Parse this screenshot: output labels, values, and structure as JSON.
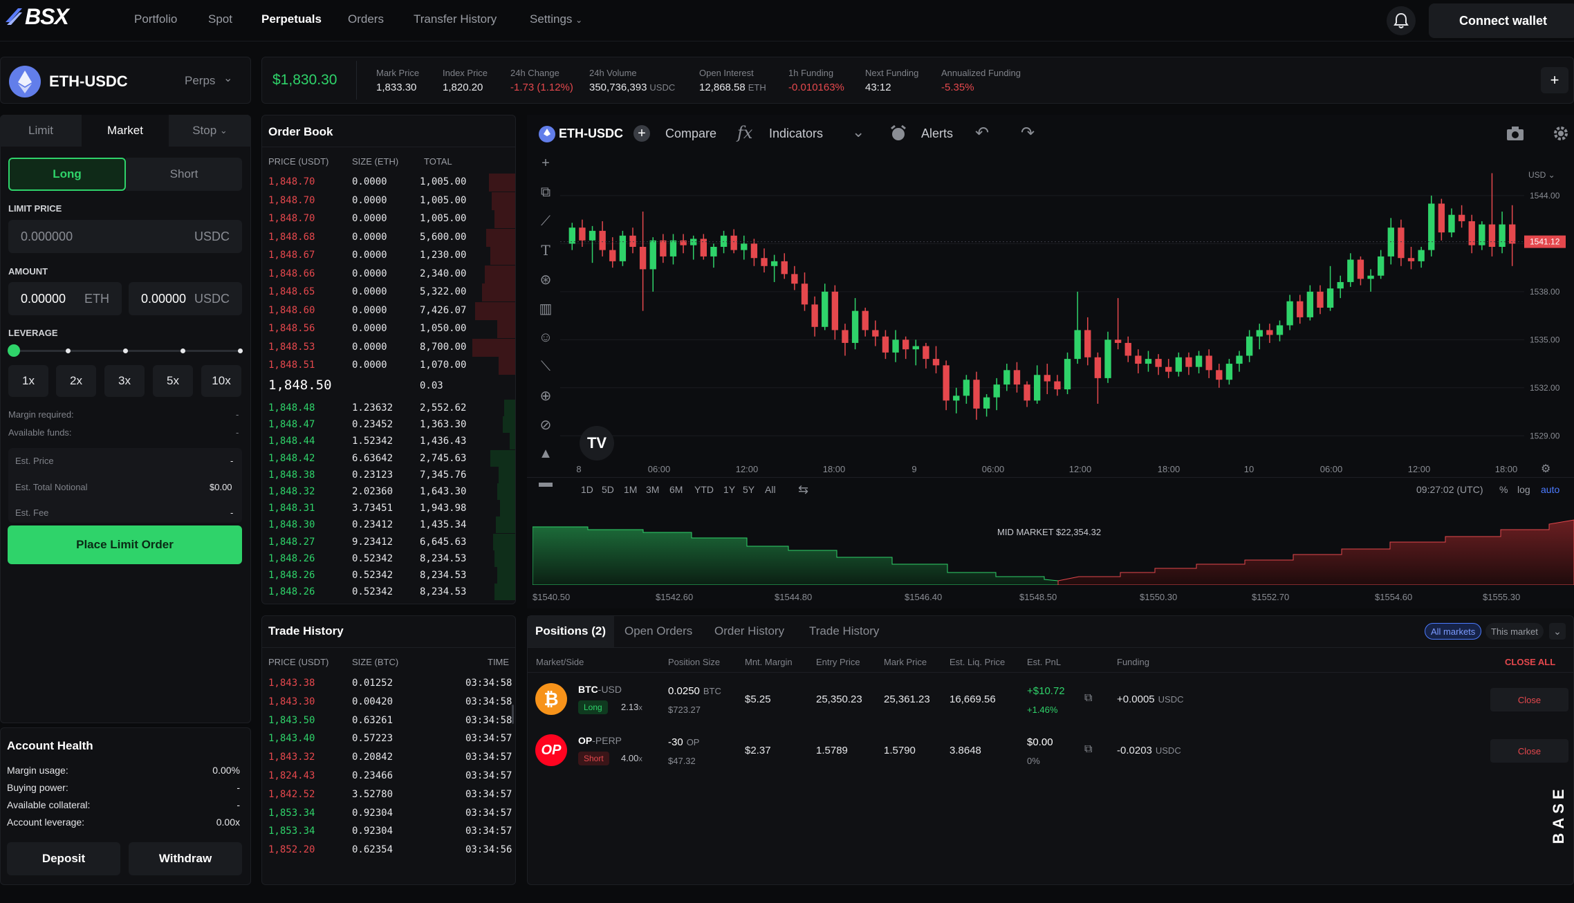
{
  "nav": {
    "logo": "BSX",
    "items": [
      "Portfolio",
      "Spot",
      "Perpetuals",
      "Orders",
      "Transfer History",
      "Settings"
    ],
    "connect": "Connect wallet"
  },
  "market": {
    "pair": "ETH-USDC",
    "type": "Perps",
    "price": "$1,830.30",
    "stats": [
      {
        "label": "Mark Price",
        "value": "1,833.30",
        "unit": "",
        "color": "#e6e7ea"
      },
      {
        "label": "Index Price",
        "value": "1,820.20",
        "unit": "",
        "color": "#e6e7ea"
      },
      {
        "label": "24h Change",
        "value": "-1.73 (1.12%)",
        "unit": "",
        "color": "#e5484d"
      },
      {
        "label": "24h Volume",
        "value": "350,736,393",
        "unit": "USDC",
        "color": "#e6e7ea"
      },
      {
        "label": "Open Interest",
        "value": "12,868.58",
        "unit": "ETH",
        "color": "#e6e7ea"
      },
      {
        "label": "1h Funding",
        "value": "-0.010163%",
        "unit": "",
        "color": "#e5484d"
      },
      {
        "label": "Next Funding",
        "value": "43:12",
        "unit": "",
        "color": "#e6e7ea"
      },
      {
        "label": "Annualized Funding",
        "value": "-5.35%",
        "unit": "",
        "color": "#e5484d"
      }
    ],
    "plus": "+"
  },
  "order_form": {
    "tabs": [
      "Limit",
      "Market",
      "Stop"
    ],
    "long": "Long",
    "short": "Short",
    "limit_price_label": "LIMIT PRICE",
    "limit_price_placeholder": "0.000000",
    "limit_price_unit": "USDC",
    "amount_label": "AMOUNT",
    "amount_eth": "0.00000",
    "amount_eth_unit": "ETH",
    "amount_usdc": "0.00000",
    "amount_usdc_unit": "USDC",
    "leverage_label": "LEVERAGE",
    "leverage_options": [
      "1x",
      "2x",
      "3x",
      "5x",
      "10x"
    ],
    "margin_required_label": "Margin required:",
    "margin_required": "-",
    "available_funds_label": "Available funds:",
    "available_funds": "-",
    "est_price_label": "Est. Price",
    "est_price": "-",
    "est_notional_label": "Est. Total Notional",
    "est_notional": "$0.00",
    "est_fee_label": "Est. Fee",
    "est_fee": "-",
    "place_order": "Place Limit Order"
  },
  "account": {
    "title": "Account Health",
    "rows": [
      {
        "label": "Margin usage:",
        "value": "0.00%"
      },
      {
        "label": "Buying power:",
        "value": "-"
      },
      {
        "label": "Available collateral:",
        "value": "-"
      },
      {
        "label": "Account leverage:",
        "value": "0.00x"
      }
    ],
    "deposit": "Deposit",
    "withdraw": "Withdraw"
  },
  "order_book": {
    "title": "Order Book",
    "headers": [
      "PRICE (USDT)",
      "SIZE (ETH)",
      "TOTAL"
    ],
    "asks": [
      [
        "1,848.70",
        "0.0000",
        "1,005.00"
      ],
      [
        "1,848.70",
        "0.0000",
        "1,005.00"
      ],
      [
        "1,848.70",
        "0.0000",
        "1,005.00"
      ],
      [
        "1,848.68",
        "0.0000",
        "5,600.00"
      ],
      [
        "1,848.67",
        "0.0000",
        "1,230.00"
      ],
      [
        "1,848.66",
        "0.0000",
        "2,340.00"
      ],
      [
        "1,848.65",
        "0.0000",
        "5,322.00"
      ],
      [
        "1,848.60",
        "0.0000",
        "7,426.07"
      ],
      [
        "1,848.56",
        "0.0000",
        "1,050.00"
      ],
      [
        "1,848.53",
        "0.0000",
        "8,700.00"
      ],
      [
        "1,848.51",
        "0.0000",
        "1,070.00"
      ]
    ],
    "mid_price": "1,848.50",
    "mid_size": "0.03",
    "bids": [
      [
        "1,848.48",
        "1.23632",
        "2,552.62"
      ],
      [
        "1,848.47",
        "0.23452",
        "1,363.30"
      ],
      [
        "1,848.44",
        "1.52342",
        "1,436.43"
      ],
      [
        "1,848.42",
        "6.63642",
        "2,745.63"
      ],
      [
        "1,848.38",
        "0.23123",
        "7,345.76"
      ],
      [
        "1,848.32",
        "2.02360",
        "1,643.30"
      ],
      [
        "1,848.31",
        "3.73451",
        "1,943.98"
      ],
      [
        "1,848.30",
        "0.23412",
        "1,435.34"
      ],
      [
        "1,848.27",
        "9.23412",
        "6,645.63"
      ],
      [
        "1,848.26",
        "0.52342",
        "8,234.53"
      ],
      [
        "1,848.26",
        "0.52342",
        "8,234.53"
      ],
      [
        "1,848.26",
        "0.52342",
        "8,234.53"
      ]
    ]
  },
  "trade_history": {
    "title": "Trade History",
    "headers": [
      "PRICE (USDT)",
      "SIZE (BTC)",
      "TIME"
    ],
    "rows": [
      {
        "price": "1,843.38",
        "size": "0.01252",
        "time": "03:34:58",
        "side": "sell"
      },
      {
        "price": "1,843.30",
        "size": "0.00420",
        "time": "03:34:58",
        "side": "sell"
      },
      {
        "price": "1,843.50",
        "size": "0.63261",
        "time": "03:34:58",
        "side": "buy"
      },
      {
        "price": "1,843.40",
        "size": "0.57223",
        "time": "03:34:57",
        "side": "buy"
      },
      {
        "price": "1,843.32",
        "size": "0.20842",
        "time": "03:34:57",
        "side": "sell"
      },
      {
        "price": "1,824.43",
        "size": "0.23466",
        "time": "03:34:57",
        "side": "sell"
      },
      {
        "price": "1,842.52",
        "size": "3.52780",
        "time": "03:34:57",
        "side": "sell"
      },
      {
        "price": "1,853.34",
        "size": "0.92304",
        "time": "03:34:57",
        "side": "buy"
      },
      {
        "price": "1,853.34",
        "size": "0.92304",
        "time": "03:34:57",
        "side": "buy"
      },
      {
        "price": "1,852.20",
        "size": "0.62354",
        "time": "03:34:56",
        "side": "sell"
      }
    ]
  },
  "chart": {
    "symbol": "ETH-USDC",
    "compare": "Compare",
    "indicators": "Indicators",
    "alerts": "Alerts",
    "currency": "USD",
    "current_price_tag": "1541.12",
    "y_ticks": [
      "1544.00",
      "1541.12",
      "1538.00",
      "1535.00",
      "1532.00",
      "1529.00"
    ],
    "x_ticks": [
      "8",
      "06:00",
      "12:00",
      "18:00",
      "9",
      "06:00",
      "12:00",
      "18:00",
      "10",
      "06:00",
      "12:00",
      "18:00"
    ],
    "timeframes": [
      "1D",
      "5D",
      "1M",
      "3M",
      "6M",
      "YTD",
      "1Y",
      "5Y",
      "All"
    ],
    "clock": "09:27:02 (UTC)",
    "scale_opts": [
      "%",
      "log",
      "auto"
    ],
    "brand": "TV"
  },
  "depth": {
    "mid_label": "MID MARKET $22,354.32",
    "x_ticks": [
      "$1540.50",
      "$1542.60",
      "$1544.80",
      "$1546.40",
      "$1548.50",
      "$1550.30",
      "$1552.70",
      "$1554.60",
      "$1555.30"
    ]
  },
  "positions": {
    "tabs": [
      "Positions (2)",
      "Open Orders",
      "Order History",
      "Trade History"
    ],
    "filters": [
      "All markets",
      "This market"
    ],
    "headers": [
      "Market/Side",
      "Position Size",
      "Mnt. Margin",
      "Entry Price",
      "Mark Price",
      "Est. Liq. Price",
      "Est. PnL",
      "Funding"
    ],
    "close_all": "CLOSE ALL",
    "rows": [
      {
        "icon": "bitcoin-icon",
        "market": "BTC",
        "quote": "-USD",
        "side": "Long",
        "lev": "2.13",
        "lev_x": "x",
        "size": "0.0250",
        "size_unit": "BTC",
        "size_usd": "$723.27",
        "margin": "$5.25",
        "entry": "25,350.23",
        "mark": "25,361.23",
        "liq": "16,669.56",
        "pnl": "+$10.72",
        "pnl_pct": "+1.46%",
        "funding": "+0.0005",
        "funding_unit": "USDC",
        "close": "Close"
      },
      {
        "icon": "op-icon",
        "market": "OP",
        "quote": "-PERP",
        "side": "Short",
        "lev": "4.00",
        "lev_x": "x",
        "size": "-30",
        "size_unit": "OP",
        "size_usd": "$47.32",
        "margin": "$2.37",
        "entry": "1.5789",
        "mark": "1.5790",
        "liq": "3.8648",
        "pnl": "$0.00",
        "pnl_pct": "0%",
        "funding": "-0.0203",
        "funding_unit": "USDC",
        "close": "Close"
      }
    ],
    "base_badge": "BASE"
  },
  "colors": {
    "green": "#2fd36a",
    "red": "#e5484d",
    "accent": "#4c7bff"
  },
  "candles": [
    [
      1541.0,
      1542.3,
      1540.6,
      1542.0
    ],
    [
      1542.0,
      1542.5,
      1540.8,
      1541.2
    ],
    [
      1541.2,
      1542.1,
      1539.8,
      1541.8
    ],
    [
      1541.8,
      1542.4,
      1540.2,
      1540.6
    ],
    [
      1540.6,
      1541.4,
      1539.5,
      1539.9
    ],
    [
      1539.9,
      1541.8,
      1539.6,
      1541.5
    ],
    [
      1541.5,
      1542.0,
      1540.4,
      1540.8
    ],
    [
      1540.8,
      1543.0,
      1536.8,
      1539.4
    ],
    [
      1539.4,
      1541.4,
      1538.0,
      1541.2
    ],
    [
      1541.2,
      1541.6,
      1539.8,
      1540.2
    ],
    [
      1540.2,
      1541.6,
      1539.7,
      1541.2
    ],
    [
      1541.2,
      1541.6,
      1540.4,
      1540.9
    ],
    [
      1540.9,
      1541.5,
      1540.0,
      1541.3
    ],
    [
      1541.3,
      1541.6,
      1540.0,
      1540.2
    ],
    [
      1540.2,
      1541.0,
      1539.5,
      1540.8
    ],
    [
      1540.8,
      1541.8,
      1540.4,
      1541.5
    ],
    [
      1541.5,
      1541.9,
      1540.4,
      1540.6
    ],
    [
      1540.6,
      1541.5,
      1540.0,
      1541.0
    ],
    [
      1541.0,
      1541.3,
      1539.6,
      1540.1
    ],
    [
      1540.1,
      1540.7,
      1539.2,
      1539.6
    ],
    [
      1539.6,
      1540.3,
      1538.6,
      1539.9
    ],
    [
      1539.9,
      1540.4,
      1538.8,
      1539.1
    ],
    [
      1539.1,
      1539.6,
      1538.1,
      1538.5
    ],
    [
      1538.5,
      1539.2,
      1536.8,
      1537.2
    ],
    [
      1537.2,
      1537.7,
      1535.2,
      1535.8
    ],
    [
      1535.8,
      1538.5,
      1535.6,
      1538.0
    ],
    [
      1538.0,
      1538.4,
      1535.0,
      1535.6
    ],
    [
      1535.6,
      1536.0,
      1534.0,
      1534.8
    ],
    [
      1534.8,
      1537.6,
      1534.4,
      1536.8
    ],
    [
      1536.8,
      1537.0,
      1535.2,
      1535.6
    ],
    [
      1535.6,
      1536.2,
      1534.6,
      1535.2
    ],
    [
      1535.2,
      1535.6,
      1533.8,
      1534.2
    ],
    [
      1534.2,
      1535.6,
      1533.6,
      1535.0
    ],
    [
      1535.0,
      1535.2,
      1533.8,
      1534.4
    ],
    [
      1534.4,
      1535.0,
      1533.4,
      1534.6
    ],
    [
      1534.6,
      1534.8,
      1533.2,
      1533.8
    ],
    [
      1533.8,
      1534.6,
      1532.9,
      1533.4
    ],
    [
      1533.4,
      1533.7,
      1530.6,
      1531.2
    ],
    [
      1531.2,
      1532.0,
      1530.4,
      1531.5
    ],
    [
      1531.5,
      1532.8,
      1531.0,
      1532.5
    ],
    [
      1532.5,
      1533.0,
      1530.0,
      1530.7
    ],
    [
      1530.7,
      1531.6,
      1530.2,
      1531.4
    ],
    [
      1531.4,
      1532.6,
      1530.6,
      1532.2
    ],
    [
      1532.2,
      1533.5,
      1531.8,
      1533.1
    ],
    [
      1533.1,
      1533.6,
      1531.7,
      1532.2
    ],
    [
      1532.2,
      1532.4,
      1530.8,
      1531.2
    ],
    [
      1531.2,
      1533.4,
      1531.0,
      1532.8
    ],
    [
      1532.8,
      1533.5,
      1531.6,
      1532.4
    ],
    [
      1532.4,
      1532.8,
      1531.5,
      1531.9
    ],
    [
      1531.9,
      1534.2,
      1531.6,
      1533.8
    ],
    [
      1533.8,
      1538.0,
      1533.5,
      1535.6
    ],
    [
      1535.6,
      1536.4,
      1533.4,
      1533.9
    ],
    [
      1533.9,
      1534.2,
      1531.0,
      1532.6
    ],
    [
      1532.6,
      1535.5,
      1532.3,
      1535.0
    ],
    [
      1535.0,
      1537.6,
      1534.4,
      1534.8
    ],
    [
      1534.8,
      1535.2,
      1533.6,
      1534.0
    ],
    [
      1534.0,
      1534.4,
      1532.9,
      1533.5
    ],
    [
      1533.5,
      1534.3,
      1533.0,
      1533.8
    ],
    [
      1533.8,
      1534.1,
      1532.8,
      1533.3
    ],
    [
      1533.3,
      1533.8,
      1532.6,
      1533.0
    ],
    [
      1533.0,
      1534.2,
      1532.7,
      1533.9
    ],
    [
      1533.9,
      1534.2,
      1532.8,
      1533.3
    ],
    [
      1533.3,
      1534.3,
      1532.9,
      1534.0
    ],
    [
      1534.0,
      1534.4,
      1532.6,
      1533.1
    ],
    [
      1533.1,
      1533.5,
      1532.0,
      1532.5
    ],
    [
      1532.5,
      1533.8,
      1532.2,
      1533.5
    ],
    [
      1533.5,
      1534.3,
      1533.0,
      1534.0
    ],
    [
      1534.0,
      1535.6,
      1533.6,
      1535.2
    ],
    [
      1535.2,
      1536.0,
      1534.4,
      1535.6
    ],
    [
      1535.6,
      1536.0,
      1534.8,
      1535.3
    ],
    [
      1535.3,
      1536.2,
      1534.9,
      1535.9
    ],
    [
      1535.9,
      1537.8,
      1535.6,
      1537.4
    ],
    [
      1537.4,
      1537.8,
      1536.0,
      1536.4
    ],
    [
      1536.4,
      1538.4,
      1536.2,
      1538.0
    ],
    [
      1538.0,
      1538.4,
      1536.6,
      1537.0
    ],
    [
      1537.0,
      1539.6,
      1536.8,
      1538.2
    ],
    [
      1538.2,
      1539.0,
      1537.6,
      1538.6
    ],
    [
      1538.6,
      1540.4,
      1538.3,
      1540.0
    ],
    [
      1540.0,
      1540.2,
      1538.4,
      1538.8
    ],
    [
      1538.8,
      1539.4,
      1538.0,
      1539.0
    ],
    [
      1539.0,
      1540.6,
      1538.8,
      1540.2
    ],
    [
      1540.2,
      1542.6,
      1539.7,
      1542.0
    ],
    [
      1542.0,
      1542.5,
      1539.6,
      1540.1
    ],
    [
      1540.1,
      1540.8,
      1539.4,
      1539.9
    ],
    [
      1539.9,
      1540.8,
      1539.5,
      1540.6
    ],
    [
      1540.6,
      1544.0,
      1540.2,
      1543.5
    ],
    [
      1543.5,
      1543.8,
      1541.2,
      1541.7
    ],
    [
      1541.7,
      1543.2,
      1541.4,
      1542.8
    ],
    [
      1542.8,
      1543.4,
      1542.0,
      1542.4
    ],
    [
      1542.4,
      1542.8,
      1540.4,
      1540.9
    ],
    [
      1540.9,
      1542.4,
      1540.6,
      1542.2
    ],
    [
      1542.2,
      1545.4,
      1540.2,
      1540.8
    ],
    [
      1540.8,
      1543.0,
      1540.4,
      1542.2
    ],
    [
      1542.2,
      1543.4,
      1539.6,
      1541.0
    ]
  ]
}
